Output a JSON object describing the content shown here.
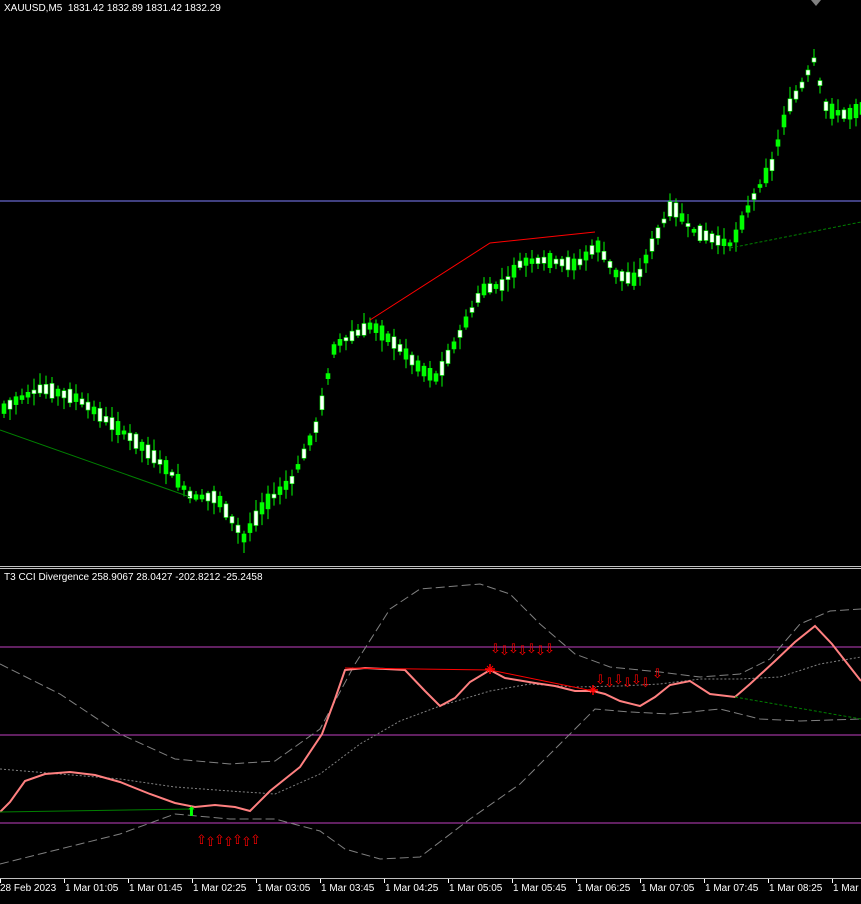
{
  "main_pane": {
    "label": "XAUUSD,M5  1831.42 1832.89 1831.42 1832.29",
    "colors": {
      "bull": "#00ff00",
      "bear": "#ffffff",
      "wick": "#00ff00",
      "hline": "#8080ff",
      "bear_div": "#ff0000",
      "bull_div": "#008000"
    }
  },
  "indicator_pane": {
    "label": "T3 CCI Divergence 258.9067 28.0427 -202.8212 -25.2458",
    "colors": {
      "cci": "#ff8080",
      "bands": "#808080",
      "levels": "#c040c0",
      "sell_arrow": "#ff0000",
      "buy_arrow": "#00ff00"
    },
    "sell_arrow_icon": "⇩",
    "buy_arrow_icon": "⇧"
  },
  "time_axis": {
    "labels": [
      "28 Feb 2023",
      "1 Mar 01:05",
      "1 Mar 01:45",
      "1 Mar 02:25",
      "1 Mar 03:05",
      "1 Mar 03:45",
      "1 Mar 04:25",
      "1 Mar 05:05",
      "1 Mar 05:45",
      "1 Mar 06:25",
      "1 Mar 07:05",
      "1 Mar 07:45",
      "1 Mar 08:25",
      "1 Mar 0"
    ]
  }
}
